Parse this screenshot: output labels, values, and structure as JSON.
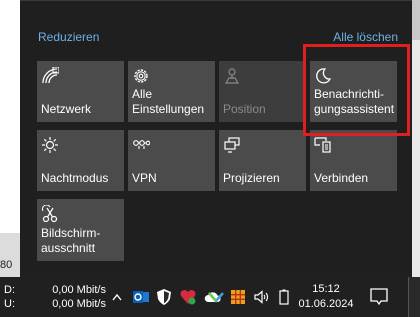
{
  "action_center": {
    "collapse_label": "Reduzieren",
    "clear_all_label": "Alle löschen",
    "tiles": [
      {
        "label": "Netzwerk",
        "icon": "network-icon",
        "enabled": true
      },
      {
        "label": "Alle\nEinstellungen",
        "icon": "gear-icon",
        "enabled": true
      },
      {
        "label": "Position",
        "icon": "location-icon",
        "enabled": false
      },
      {
        "label": "Benachrichti-\ngungsassistent",
        "icon": "moon-icon",
        "enabled": true,
        "highlighted": true
      },
      {
        "label": "Nachtmodus",
        "icon": "brightness-icon",
        "enabled": true
      },
      {
        "label": "VPN",
        "icon": "vpn-icon",
        "enabled": true
      },
      {
        "label": "Projizieren",
        "icon": "project-icon",
        "enabled": true
      },
      {
        "label": "Verbinden",
        "icon": "connect-icon",
        "enabled": true
      },
      {
        "label": "Bildschirm-\nausschnitt",
        "icon": "snip-icon",
        "enabled": true
      }
    ],
    "highlight_color": "#e02020"
  },
  "left_fragment_text": "80",
  "taskbar": {
    "net_down_label": "D:",
    "net_up_label": "U:",
    "net_down_value": "0,00 Mbit/s",
    "net_up_value": "0,00 Mbit/s",
    "tray_icons": [
      "chevron-up-icon",
      "outlook-icon",
      "shield-icon",
      "vpn-heart-icon",
      "cloud-icon",
      "wifi-extender-icon",
      "grid-app-icon",
      "volume-icon",
      "battery-icon"
    ],
    "time": "15:12",
    "date": "01.06.2024",
    "notification_icon": "notification-icon"
  },
  "colors": {
    "panel_bg": "#1f1f1f",
    "tile_bg": "#4b4b4b",
    "link": "#6fb1e6"
  }
}
